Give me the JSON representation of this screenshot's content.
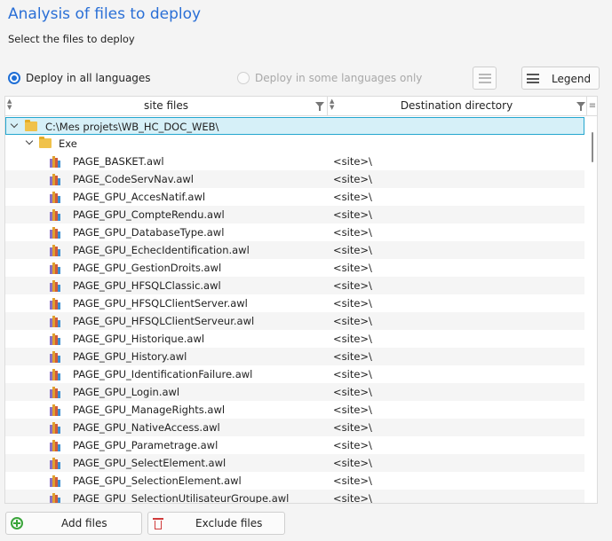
{
  "header": {
    "title": "Analysis of files to deploy",
    "subtitle": "Select the files to deploy"
  },
  "options": {
    "deploy_all_label": "Deploy in all languages",
    "deploy_all_selected": true,
    "deploy_some_label": "Deploy in some languages only",
    "deploy_some_enabled": false,
    "legend_label": "Legend"
  },
  "table": {
    "columns": [
      "site files",
      "Destination directory"
    ],
    "root": {
      "name": "C:\\Mes projets\\WB_HC_DOC_WEB\\",
      "dest": ""
    },
    "folder": {
      "name": "Exe",
      "dest": ""
    },
    "rows": [
      {
        "name": "PAGE_BASKET.awl",
        "dest": "<site>\\"
      },
      {
        "name": "PAGE_CodeServNav.awl",
        "dest": "<site>\\"
      },
      {
        "name": "PAGE_GPU_AccesNatif.awl",
        "dest": "<site>\\"
      },
      {
        "name": "PAGE_GPU_CompteRendu.awl",
        "dest": "<site>\\"
      },
      {
        "name": "PAGE_GPU_DatabaseType.awl",
        "dest": "<site>\\"
      },
      {
        "name": "PAGE_GPU_EchecIdentification.awl",
        "dest": "<site>\\"
      },
      {
        "name": "PAGE_GPU_GestionDroits.awl",
        "dest": "<site>\\"
      },
      {
        "name": "PAGE_GPU_HFSQLClassic.awl",
        "dest": "<site>\\"
      },
      {
        "name": "PAGE_GPU_HFSQLClientServer.awl",
        "dest": "<site>\\"
      },
      {
        "name": "PAGE_GPU_HFSQLClientServeur.awl",
        "dest": "<site>\\"
      },
      {
        "name": "PAGE_GPU_Historique.awl",
        "dest": "<site>\\"
      },
      {
        "name": "PAGE_GPU_History.awl",
        "dest": "<site>\\"
      },
      {
        "name": "PAGE_GPU_IdentificationFailure.awl",
        "dest": "<site>\\"
      },
      {
        "name": "PAGE_GPU_Login.awl",
        "dest": "<site>\\"
      },
      {
        "name": "PAGE_GPU_ManageRights.awl",
        "dest": "<site>\\"
      },
      {
        "name": "PAGE_GPU_NativeAccess.awl",
        "dest": "<site>\\"
      },
      {
        "name": "PAGE_GPU_Parametrage.awl",
        "dest": "<site>\\"
      },
      {
        "name": "PAGE_GPU_SelectElement.awl",
        "dest": "<site>\\"
      },
      {
        "name": "PAGE_GPU_SelectionElement.awl",
        "dest": "<site>\\"
      },
      {
        "name": "PAGE_GPU_SelectionUtilisateurGroupe.awl",
        "dest": "<site>\\"
      }
    ]
  },
  "footer": {
    "add_label": "Add files",
    "exclude_label": "Exclude files"
  },
  "icons": {
    "folder": "folder-icon",
    "file": "file-icon",
    "add": "add-icon",
    "exclude": "trash-icon",
    "legend": "menu-icon",
    "filter": "filter-icon"
  },
  "colors": {
    "title": "#2a6fd6",
    "selection_fill": "#d6f0f8",
    "selection_border": "#25a7cf",
    "add_icon": "#3aa53a",
    "exclude_icon": "#d03a3a"
  }
}
